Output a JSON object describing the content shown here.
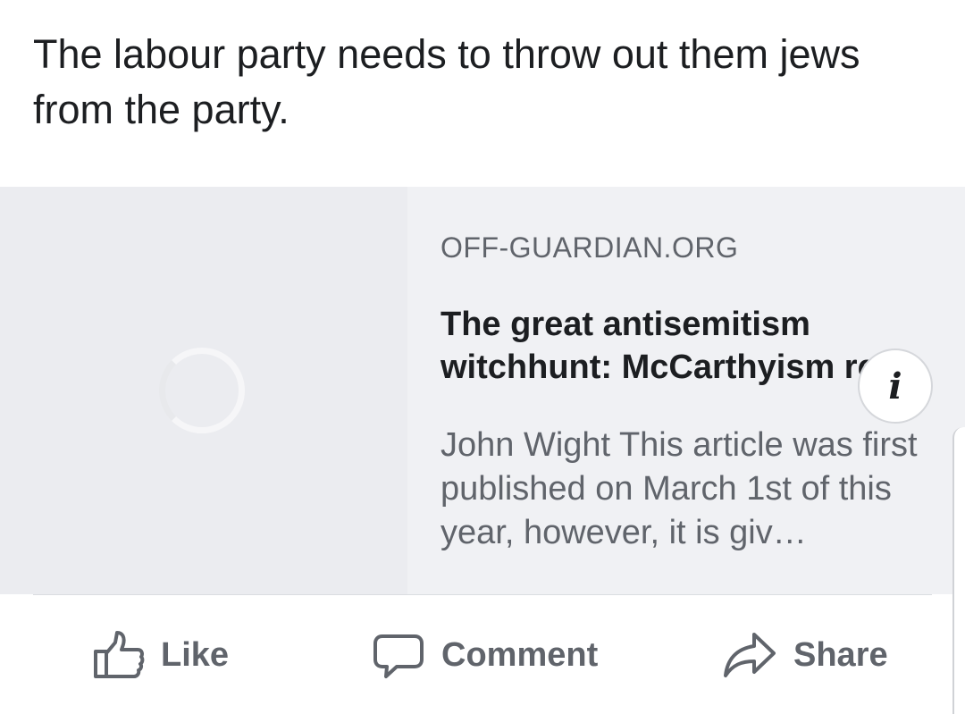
{
  "post": {
    "text": "The labour party needs to throw out them jews from the party."
  },
  "link_card": {
    "domain": "OFF-GUARDIAN.ORG",
    "headline": "The great antisemitism witchhunt: McCarthyism re…",
    "description": "John Wight This article was first published on March 1st of this year, however, it is giv…",
    "info_icon": "info-icon",
    "thumbnail_state": "loading"
  },
  "actions": {
    "like_label": "Like",
    "comment_label": "Comment",
    "share_label": "Share"
  },
  "colors": {
    "text_primary": "#1c1e21",
    "text_secondary": "#60646b",
    "card_bg": "#f0f1f4",
    "thumb_bg": "#ebecf0"
  }
}
